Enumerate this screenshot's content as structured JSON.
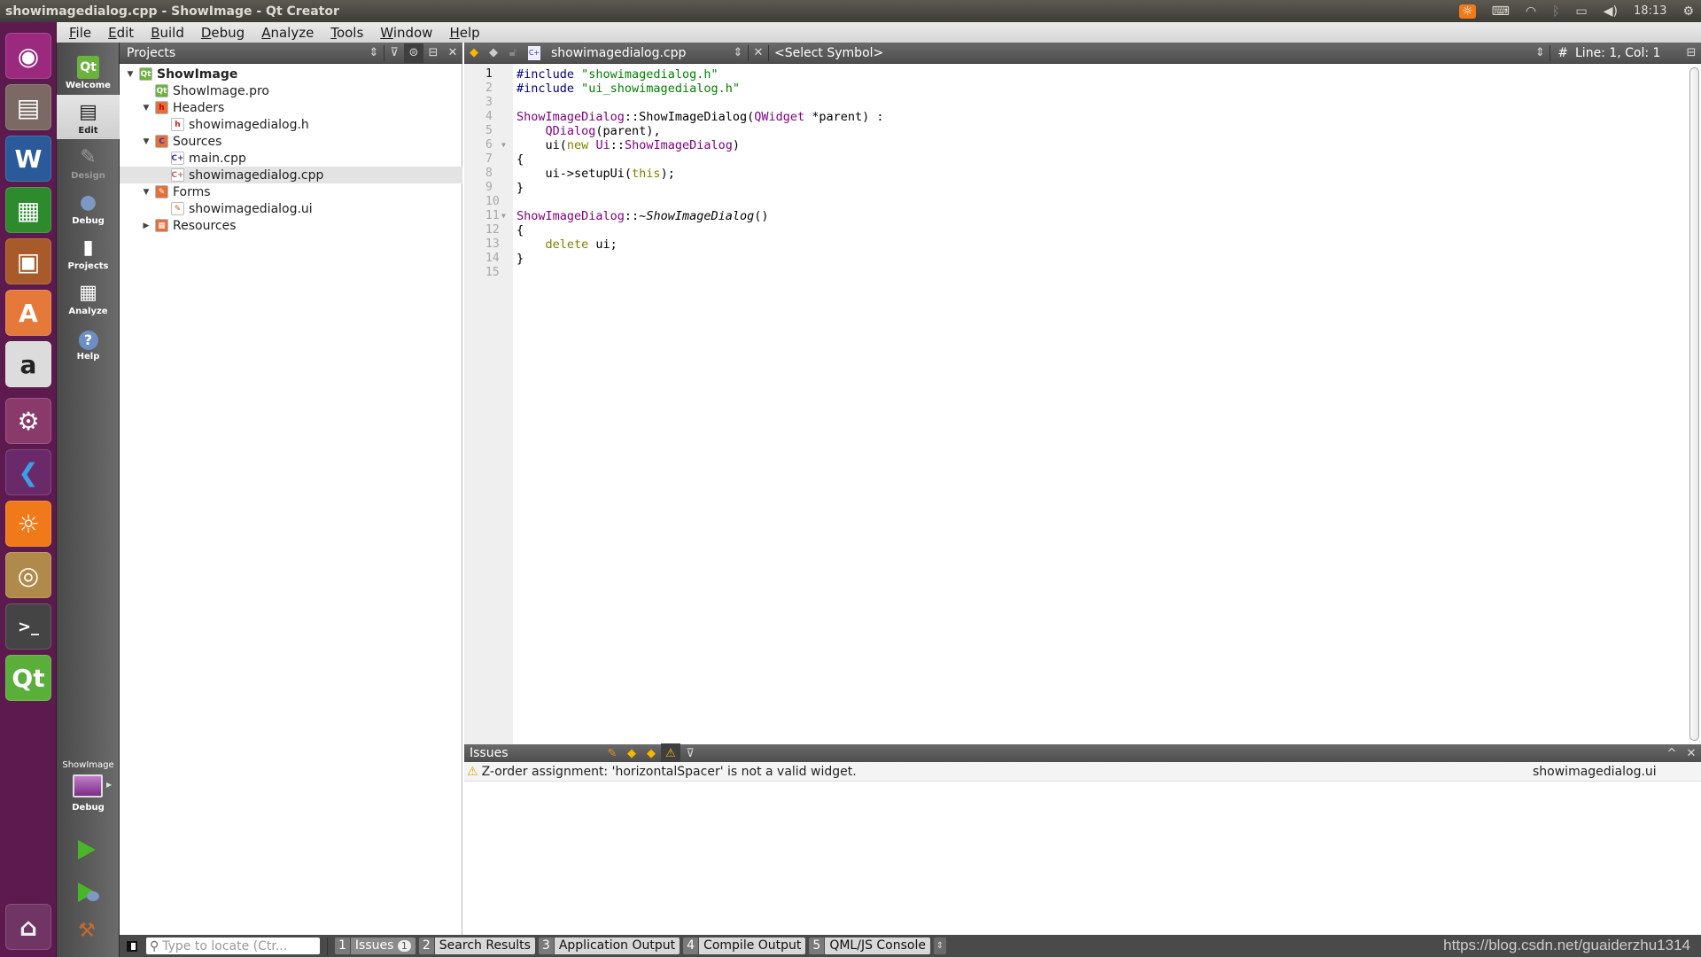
{
  "window": {
    "title": "showimagedialog.cpp - ShowImage - Qt Creator"
  },
  "tray": {
    "clock": "18:13",
    "icons": [
      "update-indicator-icon",
      "keyboard-icon",
      "wifi-icon",
      "bluetooth-icon",
      "battery-icon",
      "volume-icon",
      "power-gear-icon"
    ]
  },
  "launcher": {
    "items": [
      {
        "name": "ubuntu-dash",
        "glyph": "◉",
        "color": "#9b2a7f"
      },
      {
        "name": "files",
        "glyph": "▤",
        "color": "#7a6a63"
      },
      {
        "name": "libreoffice-writer",
        "glyph": "W",
        "color": "#2a5a9a"
      },
      {
        "name": "libreoffice-calc",
        "glyph": "▦",
        "color": "#2d8a2d"
      },
      {
        "name": "libreoffice-impress",
        "glyph": "▣",
        "color": "#a85a2a"
      },
      {
        "name": "ubuntu-software",
        "glyph": "A",
        "color": "#e5793a"
      },
      {
        "name": "amazon",
        "glyph": "a",
        "color": "#dcdcdc"
      },
      {
        "name": "system-settings",
        "glyph": "⚙",
        "color": "#8a3a6a"
      },
      {
        "name": "vscode",
        "glyph": "❮",
        "color": "#6a2a6a"
      },
      {
        "name": "video-player",
        "glyph": "☼",
        "color": "#f07a1a"
      },
      {
        "name": "chrome",
        "glyph": "◎",
        "color": "#b08a4a"
      },
      {
        "name": "terminal",
        "glyph": ">_",
        "color": "#444"
      },
      {
        "name": "qt-creator",
        "glyph": "Qt",
        "color": "#5aae3a"
      }
    ],
    "trash": {
      "glyph": "🗑"
    }
  },
  "menu": {
    "items": [
      {
        "label": "File",
        "u": "F",
        "rest": "ile"
      },
      {
        "label": "Edit",
        "u": "E",
        "rest": "dit"
      },
      {
        "label": "Build",
        "u": "B",
        "rest": "uild"
      },
      {
        "label": "Debug",
        "u": "D",
        "rest": "ebug"
      },
      {
        "label": "Analyze",
        "u": "A",
        "rest": "nalyze"
      },
      {
        "label": "Tools",
        "u": "T",
        "rest": "ools"
      },
      {
        "label": "Window",
        "u": "W",
        "rest": "indow"
      },
      {
        "label": "Help",
        "u": "H",
        "rest": "elp"
      }
    ]
  },
  "modes": [
    {
      "label": "Welcome",
      "glyph": "Qt",
      "state": "normal"
    },
    {
      "label": "Edit",
      "glyph": "▤",
      "state": "active"
    },
    {
      "label": "Design",
      "glyph": "✎",
      "state": "disabled"
    },
    {
      "label": "Debug",
      "glyph": "●",
      "state": "normal"
    },
    {
      "label": "Projects",
      "glyph": "▮",
      "state": "normal"
    },
    {
      "label": "Analyze",
      "glyph": "▦",
      "state": "normal"
    },
    {
      "label": "Help",
      "glyph": "?",
      "state": "normal"
    }
  ],
  "kit": {
    "project": "ShowImage",
    "config": "Debug"
  },
  "projects": {
    "title": "Projects",
    "tree": [
      {
        "label": "ShowImage",
        "depth": 0,
        "twisty": "▼",
        "icon": "qt",
        "bold": true
      },
      {
        "label": "ShowImage.pro",
        "depth": 1,
        "twisty": "",
        "icon": "qt"
      },
      {
        "label": "Headers",
        "depth": 1,
        "twisty": "▼",
        "icon": "folder-h"
      },
      {
        "label": "showimagedialog.h",
        "depth": 2,
        "twisty": "",
        "icon": "h"
      },
      {
        "label": "Sources",
        "depth": 1,
        "twisty": "▼",
        "icon": "folder-cpp"
      },
      {
        "label": "main.cpp",
        "depth": 2,
        "twisty": "",
        "icon": "cpp"
      },
      {
        "label": "showimagedialog.cpp",
        "depth": 2,
        "twisty": "",
        "icon": "cpp-sel",
        "selected": true
      },
      {
        "label": "Forms",
        "depth": 1,
        "twisty": "▼",
        "icon": "folder-ui"
      },
      {
        "label": "showimagedialog.ui",
        "depth": 2,
        "twisty": "",
        "icon": "ui"
      },
      {
        "label": "Resources",
        "depth": 1,
        "twisty": "▶",
        "icon": "folder-res"
      }
    ]
  },
  "editor": {
    "file": "showimagedialog.cpp",
    "symbol": "<Select Symbol>",
    "position": "Line: 1, Col: 1",
    "hash": "#",
    "current_line": 1,
    "fold_lines": [
      6,
      11
    ],
    "lines": [
      [
        {
          "t": "#include ",
          "c": "pp"
        },
        {
          "t": "\"showimagedialog.h\"",
          "c": "str"
        }
      ],
      [
        {
          "t": "#include ",
          "c": "pp"
        },
        {
          "t": "\"ui_showimagedialog.h\"",
          "c": "str"
        }
      ],
      [],
      [
        {
          "t": "ShowImageDialog",
          "c": "cls"
        },
        {
          "t": "::ShowImageDialog(",
          "c": ""
        },
        {
          "t": "QWidget",
          "c": "cls"
        },
        {
          "t": " *parent) :",
          "c": ""
        }
      ],
      [
        {
          "t": "    ",
          "c": ""
        },
        {
          "t": "QDialog",
          "c": "cls"
        },
        {
          "t": "(parent),",
          "c": ""
        }
      ],
      [
        {
          "t": "    ui(",
          "c": ""
        },
        {
          "t": "new",
          "c": "kw"
        },
        {
          "t": " ",
          "c": ""
        },
        {
          "t": "Ui",
          "c": "cls"
        },
        {
          "t": "::",
          "c": ""
        },
        {
          "t": "ShowImageDialog",
          "c": "cls"
        },
        {
          "t": ")",
          "c": ""
        }
      ],
      [
        {
          "t": "{",
          "c": ""
        }
      ],
      [
        {
          "t": "    ui->setupUi(",
          "c": ""
        },
        {
          "t": "this",
          "c": "kw"
        },
        {
          "t": ");",
          "c": ""
        }
      ],
      [
        {
          "t": "}",
          "c": ""
        }
      ],
      [],
      [
        {
          "t": "ShowImageDialog",
          "c": "cls"
        },
        {
          "t": "::~",
          "c": ""
        },
        {
          "t": "ShowImageDialog",
          "c": "it"
        },
        {
          "t": "()",
          "c": ""
        }
      ],
      [
        {
          "t": "{",
          "c": ""
        }
      ],
      [
        {
          "t": "    ",
          "c": ""
        },
        {
          "t": "delete",
          "c": "kw"
        },
        {
          "t": " ui;",
          "c": ""
        }
      ],
      [
        {
          "t": "}",
          "c": ""
        }
      ],
      []
    ]
  },
  "issues": {
    "title": "Issues",
    "rows": [
      {
        "message": "Z-order assignment: 'horizontalSpacer' is not a valid widget.",
        "file": "showimagedialog.ui",
        "severity": "warning"
      }
    ]
  },
  "statusbar": {
    "locator_placeholder": "Type to locate (Ctr...",
    "panes": [
      {
        "num": "1",
        "label": "Issues",
        "badge": "1"
      },
      {
        "num": "2",
        "label": "Search Results"
      },
      {
        "num": "3",
        "label": "Application Output"
      },
      {
        "num": "4",
        "label": "Compile Output"
      },
      {
        "num": "5",
        "label": "QML/JS Console"
      }
    ],
    "watermark": "https://blog.csdn.net/guaiderzhu1314"
  }
}
